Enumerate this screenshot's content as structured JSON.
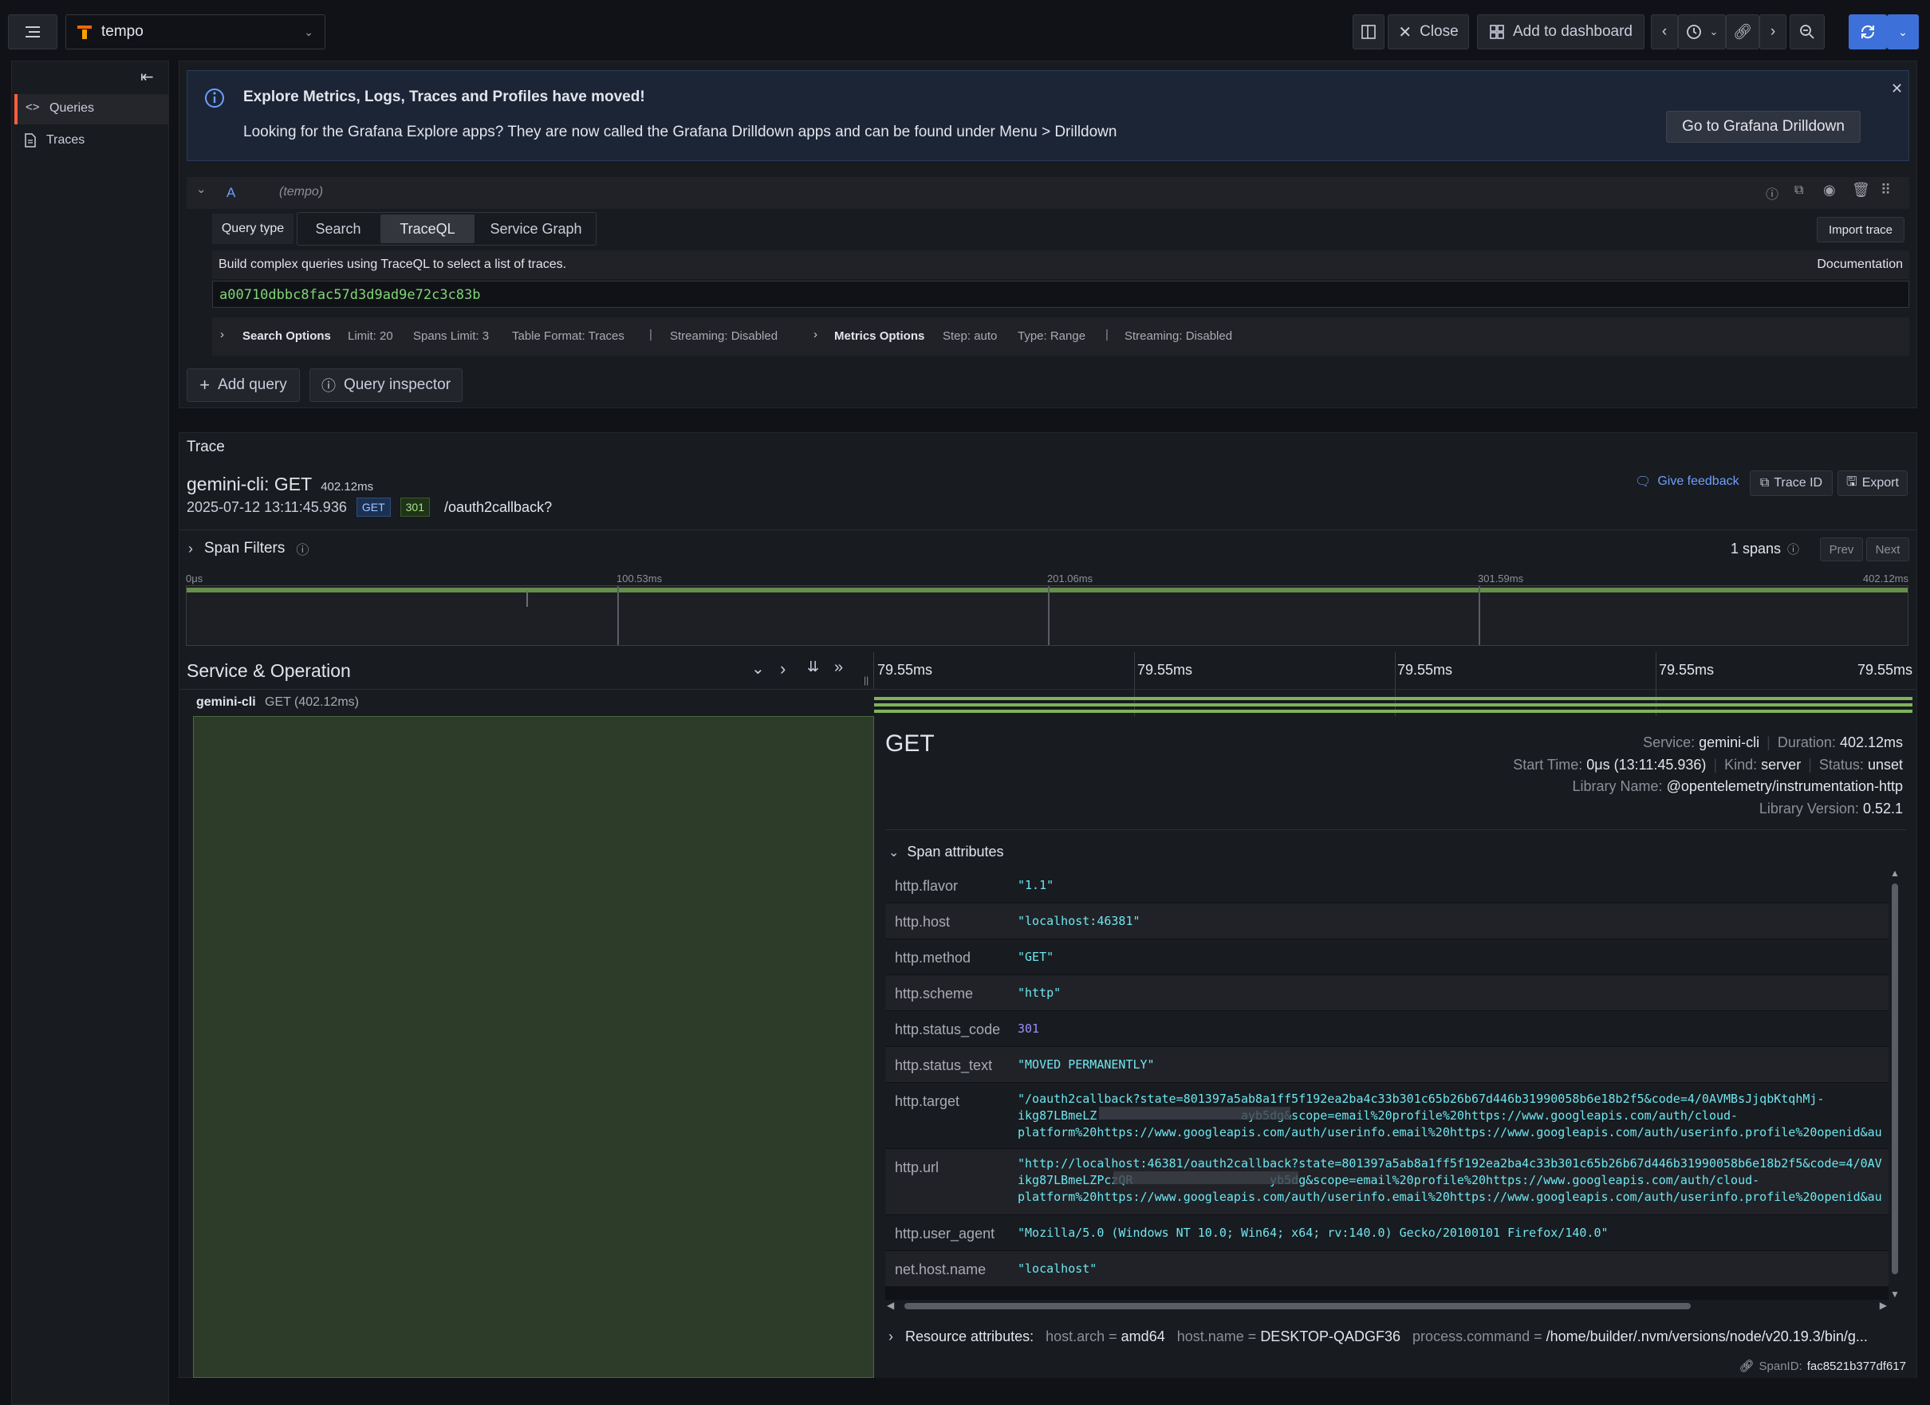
{
  "topbar": {
    "datasource": "tempo",
    "close_label": "Close",
    "add_dashboard_label": "Add to dashboard"
  },
  "sidebar": {
    "items": [
      {
        "label": "Queries",
        "icon": "code-icon"
      },
      {
        "label": "Traces",
        "icon": "document-icon"
      }
    ]
  },
  "banner": {
    "title": "Explore Metrics, Logs, Traces and Profiles have moved!",
    "body": "Looking for the Grafana Explore apps? They are now called the Grafana Drilldown apps and can be found under Menu > Drilldown",
    "button": "Go to Grafana Drilldown"
  },
  "query": {
    "ref": "A",
    "datasource": "(tempo)",
    "query_type_label": "Query type",
    "tabs": [
      "Search",
      "TraceQL",
      "Service Graph"
    ],
    "active_tab": "TraceQL",
    "import_label": "Import trace",
    "help_text": "Build complex queries using TraceQL to select a list of traces.",
    "docs_label": "Documentation",
    "value": "a00710dbbc8fac57d3d9ad9e72c3c83b",
    "search_options_label": "Search Options",
    "limit": "Limit: 20",
    "spans_limit": "Spans Limit: 3",
    "table_format": "Table Format: Traces",
    "streaming1": "Streaming: Disabled",
    "metrics_options_label": "Metrics Options",
    "step": "Step: auto",
    "type": "Type: Range",
    "streaming2": "Streaming: Disabled",
    "add_query": "Add query",
    "inspector": "Query inspector"
  },
  "trace": {
    "panel_title": "Trace",
    "title": "gemini-cli: GET",
    "duration": "402.12ms",
    "timestamp": "2025-07-12 13:11:45.936",
    "method_badge": "GET",
    "status_badge": "301",
    "path": "/oauth2callback?",
    "feedback": "Give feedback",
    "trace_id_btn": "Trace ID",
    "export_btn": "Export",
    "span_filters": "Span Filters",
    "span_count": "1 spans",
    "prev": "Prev",
    "next": "Next",
    "minimap_ticks": [
      "0μs",
      "100.53ms",
      "201.06ms",
      "301.59ms",
      "402.12ms"
    ],
    "service_operation": "Service & Operation",
    "timeline_ticks": [
      "79.55ms",
      "79.55ms",
      "79.55ms",
      "79.55ms",
      "79.55ms"
    ],
    "row_service": "gemini-cli",
    "row_op": "GET (402.12ms)"
  },
  "span": {
    "name": "GET",
    "service_label": "Service:",
    "service": "gemini-cli",
    "duration_label": "Duration:",
    "duration": "402.12ms",
    "start_label": "Start Time:",
    "start": "0μs (13:11:45.936)",
    "kind_label": "Kind:",
    "kind": "server",
    "status_label": "Status:",
    "status": "unset",
    "lib_name_label": "Library Name:",
    "lib_name": "@opentelemetry/instrumentation-http",
    "lib_version_label": "Library Version:",
    "lib_version": "0.52.1",
    "attributes_label": "Span attributes",
    "attributes": [
      {
        "key": "http.flavor",
        "value": "\"1.1\""
      },
      {
        "key": "http.host",
        "value": "\"localhost:46381\""
      },
      {
        "key": "http.method",
        "value": "\"GET\""
      },
      {
        "key": "http.scheme",
        "value": "\"http\""
      },
      {
        "key": "http.status_code",
        "value": "301"
      },
      {
        "key": "http.status_text",
        "value": "\"MOVED PERMANENTLY\""
      },
      {
        "key": "http.target",
        "value": "\"/oauth2callback?state=801397a5ab8a1ff5f192ea2ba4c33b301c65b26b67d446b31990058b6e18b2f5&code=4/0AVMBsJjqbKtqhMj-\nikg87LBmeLZ                    ayb5dg&scope=email%20profile%20https://www.googleapis.com/auth/cloud-\nplatform%20https://www.googleapis.com/auth/userinfo.email%20https://www.googleapis.com/auth/userinfo.profile%20openid&au"
      },
      {
        "key": "http.url",
        "value": "\"http://localhost:46381/oauth2callback?state=801397a5ab8a1ff5f192ea2ba4c33b301c65b26b67d446b31990058b6e18b2f5&code=4/0AV\nikg87LBmeLZPczQR                   yb5dg&scope=email%20profile%20https://www.googleapis.com/auth/cloud-\nplatform%20https://www.googleapis.com/auth/userinfo.email%20https://www.googleapis.com/auth/userinfo.profile%20openid&au"
      },
      {
        "key": "http.user_agent",
        "value": "\"Mozilla/5.0 (Windows NT 10.0; Win64; x64; rv:140.0) Gecko/20100101 Firefox/140.0\""
      },
      {
        "key": "net.host.name",
        "value": "\"localhost\""
      }
    ],
    "resource_label": "Resource attributes:",
    "resource": [
      {
        "key": "host.arch",
        "value": "amd64"
      },
      {
        "key": "host.name",
        "value": "DESKTOP-QADGF36"
      },
      {
        "key": "process.command",
        "value": "/home/builder/.nvm/versions/node/v20.19.3/bin/g..."
      }
    ],
    "span_id_label": "SpanID:",
    "span_id": "fac8521b377df617"
  },
  "colors": {
    "accent": "#3d71d9",
    "span_bar": "#7fb45a",
    "string_value": "#6ee5f0",
    "number_value": "#a08cff",
    "banner_bg": "#1b2536"
  }
}
